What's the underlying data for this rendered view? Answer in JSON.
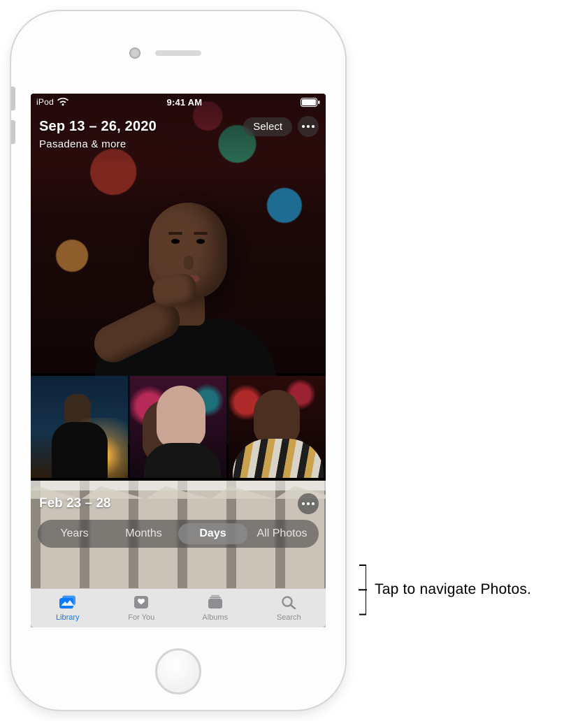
{
  "statusbar": {
    "device": "iPod",
    "time": "9:41 AM"
  },
  "hero": {
    "date_range": "Sep 13 – 26, 2020",
    "location": "Pasadena & more",
    "select_label": "Select"
  },
  "section2": {
    "date_range": "Feb 23 – 28"
  },
  "scope": {
    "items": [
      "Years",
      "Months",
      "Days",
      "All Photos"
    ],
    "active_index": 2
  },
  "tabs": {
    "items": [
      "Library",
      "For You",
      "Albums",
      "Search"
    ],
    "active_index": 0
  },
  "callout": "Tap to navigate Photos."
}
